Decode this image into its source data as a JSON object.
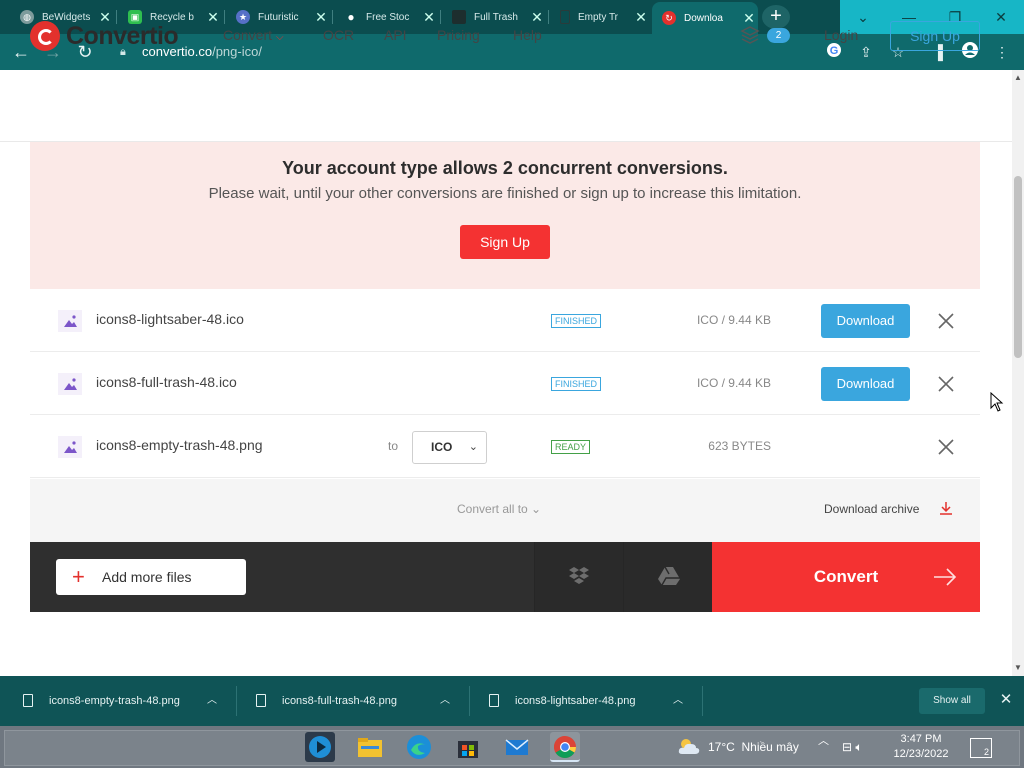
{
  "browser": {
    "tabs": [
      {
        "title": "BeWidgets",
        "favicon": "globe-icon",
        "color": "#9fb8b9"
      },
      {
        "title": "Recycle b",
        "favicon": "green-tile-icon",
        "color": "#2fbf4f"
      },
      {
        "title": "Futuristic",
        "favicon": "star-icon",
        "color": "#5670c7"
      },
      {
        "title": "Free Stoc",
        "favicon": "dot-icon",
        "color": "#ffffff"
      },
      {
        "title": "Full Trash",
        "favicon": "dark-square-icon",
        "color": "#1d2e2e"
      },
      {
        "title": "Empty Tr",
        "favicon": "page-icon",
        "color": "#1d2e2e"
      },
      {
        "title": "Downloa",
        "favicon": "convertio-icon",
        "color": "#e3312d",
        "active": true
      }
    ],
    "new_tab": "+",
    "window_controls": {
      "dropdown": "⌄",
      "minimize": "—",
      "restore": "❐",
      "close": "✕"
    },
    "url_domain": "convertio.co",
    "url_path": "/png-ico/"
  },
  "site": {
    "brand": "Convertio",
    "nav": {
      "convert": "Convert",
      "ocr": "OCR",
      "api": "API",
      "pricing": "Pricing",
      "help": "Help"
    },
    "queue_count": "2",
    "login": "Login",
    "signup": "Sign Up"
  },
  "warning": {
    "title": "Your account type allows 2 concurrent conversions.",
    "text": "Please wait, until your other conversions are finished or sign up to increase this limitation.",
    "button": "Sign Up"
  },
  "files": [
    {
      "name": "icons8-lightsaber-48.ico",
      "status": "FINISHED",
      "size": "ICO / 9.44 KB",
      "action": "Download"
    },
    {
      "name": "icons8-full-trash-48.ico",
      "status": "FINISHED",
      "size": "ICO / 9.44 KB",
      "action": "Download"
    },
    {
      "name": "icons8-empty-trash-48.png",
      "status": "READY",
      "size": "623 BYTES",
      "to": "to",
      "format": "ICO"
    }
  ],
  "bulk": {
    "convert_all": "Convert all to",
    "download_archive": "Download archive"
  },
  "actions": {
    "add_more": "Add more files",
    "convert": "Convert"
  },
  "downloads": [
    {
      "name": "icons8-empty-trash-48.png"
    },
    {
      "name": "icons8-full-trash-48.png"
    },
    {
      "name": "icons8-lightsaber-48.png"
    }
  ],
  "shelf": {
    "show_all": "Show all"
  },
  "taskbar": {
    "temperature": "17°C",
    "weather": "Nhiều mây",
    "time": "3:47 PM",
    "date": "12/23/2022",
    "notifications": "2"
  }
}
